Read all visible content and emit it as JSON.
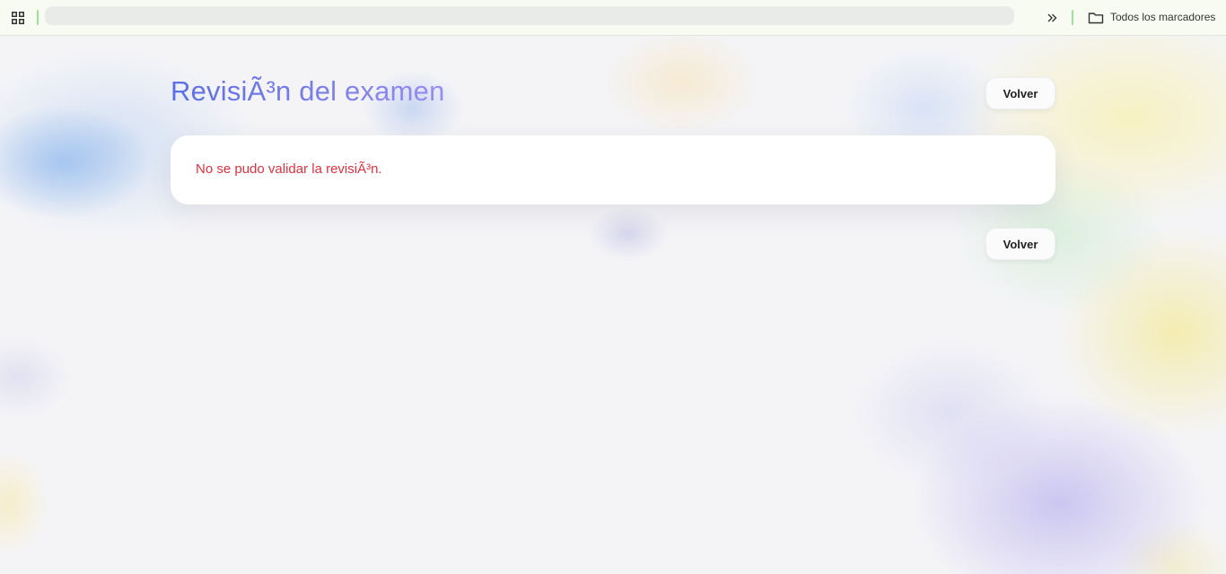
{
  "browser": {
    "bookmarks_folder_label": "Todos los marcadores",
    "icons": {
      "apps": "apps-grid-icon",
      "more": "chevron-double-right-icon",
      "folder": "folder-icon"
    }
  },
  "page": {
    "title": "RevisiÃ³n del examen",
    "back_button_top": "Volver",
    "back_button_bottom": "Volver",
    "error_message": "No se pudo validar la revisiÃ³n."
  },
  "colors": {
    "title_gradient_start": "#5b6ee6",
    "title_gradient_end": "#9a8cf0",
    "error": "#e2303f",
    "card_background": "#ffffff",
    "page_background": "#f4f4f7"
  }
}
